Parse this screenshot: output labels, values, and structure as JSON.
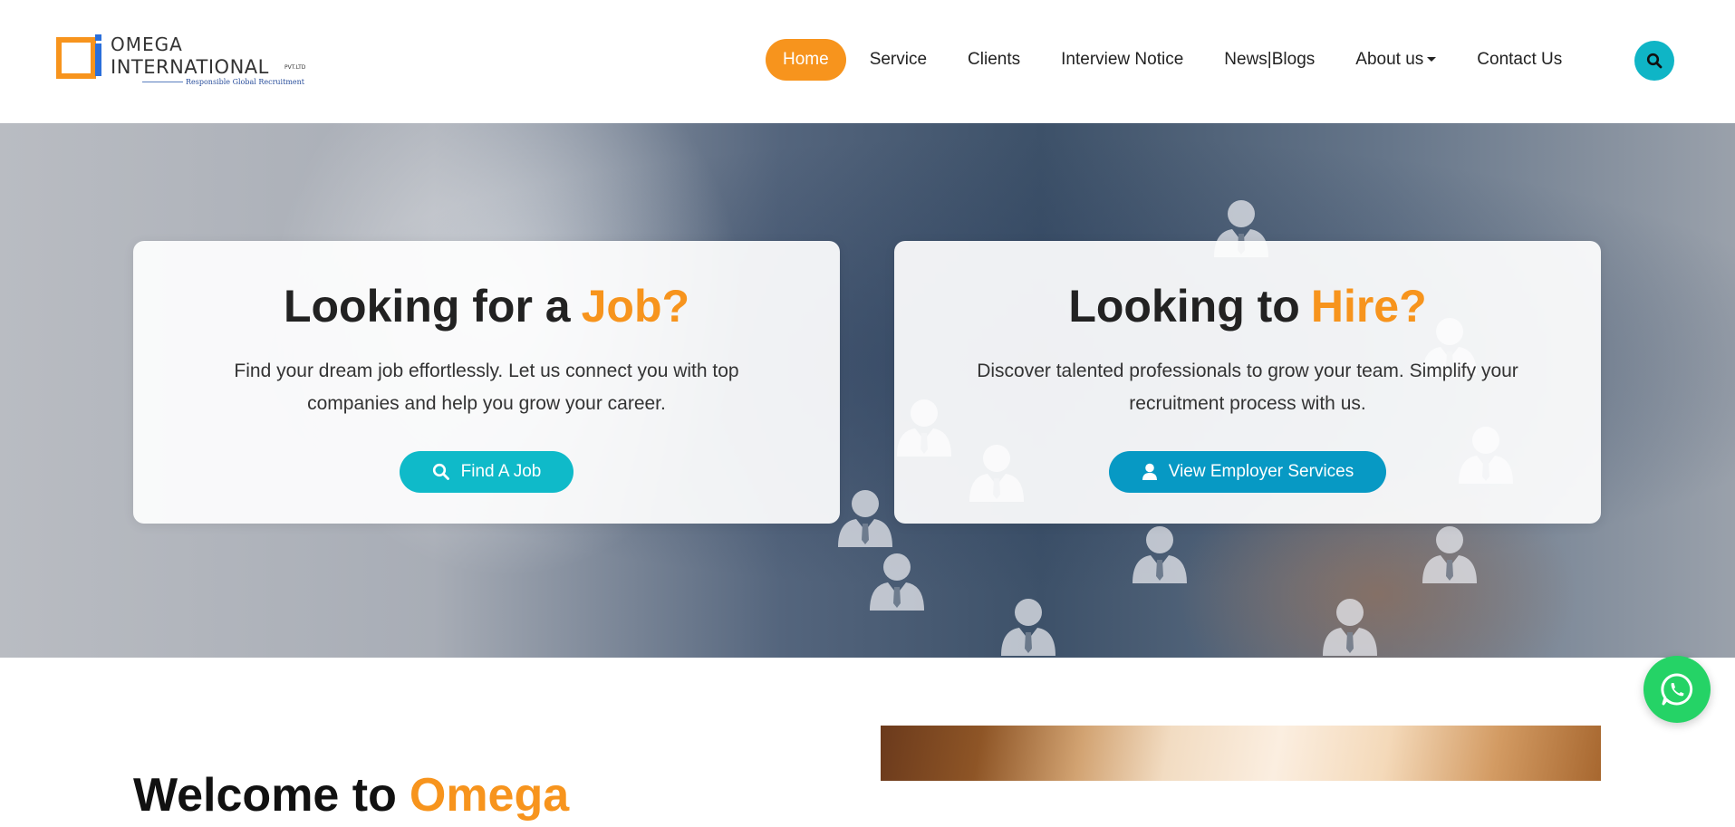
{
  "brand": {
    "name_line1": "OMEGA",
    "name_line2": "INTERNATIONAL",
    "suffix": "PVT.LTD",
    "tagline": "Responsible Global Recruitment",
    "colors": {
      "orange": "#f7941d",
      "blue": "#2a6fdb"
    }
  },
  "nav": {
    "items": [
      {
        "label": "Home",
        "active": true
      },
      {
        "label": "Service"
      },
      {
        "label": "Clients"
      },
      {
        "label": "Interview Notice"
      },
      {
        "label": "News|Blogs"
      },
      {
        "label": "About us",
        "has_dropdown": true
      },
      {
        "label": "Contact Us"
      }
    ],
    "search_icon": "search-icon"
  },
  "hero": {
    "job_card": {
      "title_prefix": "Looking for a",
      "title_accent": "Job?",
      "description": "Find your dream job effortlessly. Let us connect you with top companies and help you grow your career.",
      "button_label": "Find A Job",
      "button_icon": "search-icon"
    },
    "hire_card": {
      "title_prefix": "Looking to",
      "title_accent": "Hire?",
      "description": "Discover talented professionals to grow your team. Simplify your recruitment process with us.",
      "button_label": "View Employer Services",
      "button_icon": "user-icon"
    }
  },
  "welcome": {
    "title_prefix": "Welcome to",
    "title_accent": "Omega"
  },
  "floating": {
    "whatsapp_icon": "whatsapp-icon"
  },
  "colors": {
    "accent_orange": "#f7941d",
    "teal": "#0fbac9",
    "blue": "#0799c4",
    "whatsapp_green": "#25d366"
  }
}
